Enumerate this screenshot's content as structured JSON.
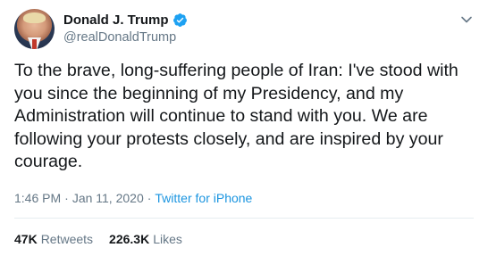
{
  "author": {
    "display_name": "Donald J. Trump",
    "handle": "@realDonaldTrump",
    "verified_icon": "verified-badge-icon"
  },
  "tweet": {
    "text": "To the brave, long-suffering people of Iran: I've stood with you since the beginning of my Presidency, and my Administration will continue to stand with you. We are following your protests closely, and are inspired by your courage.",
    "time": "1:46 PM",
    "date": "Jan 11, 2020",
    "separator": "·",
    "source": "Twitter for iPhone"
  },
  "stats": {
    "retweets_count": "47K",
    "retweets_label": "Retweets",
    "likes_count": "226.3K",
    "likes_label": "Likes"
  },
  "colors": {
    "text_primary": "#14171a",
    "text_secondary": "#657786",
    "accent": "#1b95e0",
    "divider": "#e6ecf0"
  }
}
